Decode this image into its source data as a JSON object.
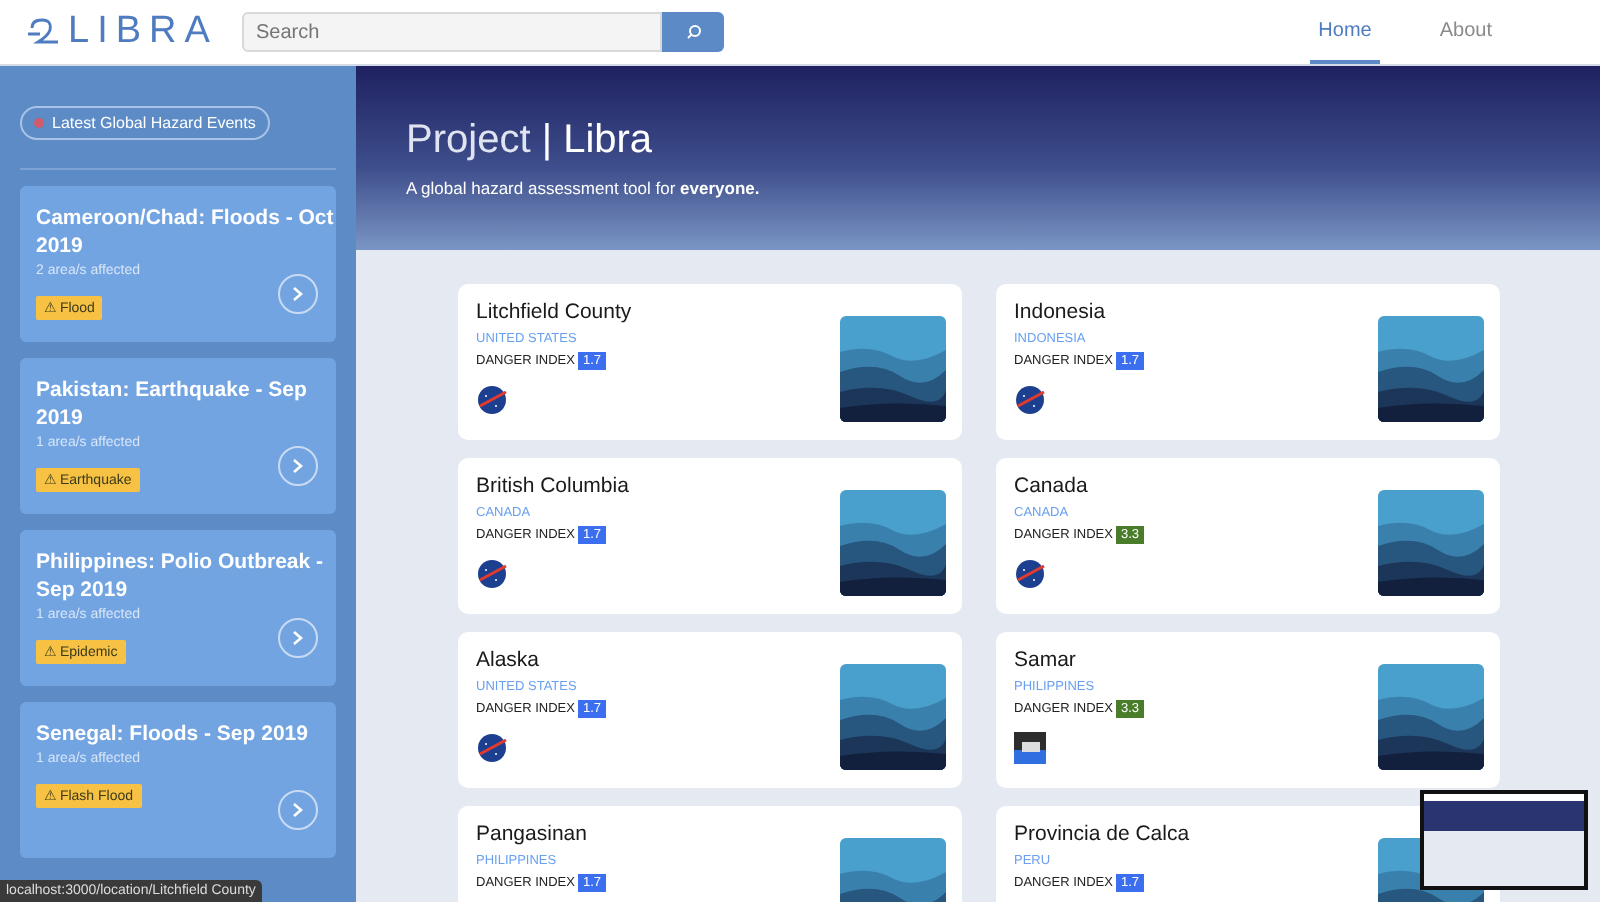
{
  "header": {
    "logo": "LIBRA",
    "search": {
      "placeholder": "Search"
    },
    "nav": [
      {
        "label": "Home",
        "selected": true
      },
      {
        "label": "About",
        "selected": false
      }
    ]
  },
  "sidebar": {
    "live_badge": "Latest Global Hazard Events",
    "events": [
      {
        "title": "Cameroon/Chad: Floods - Oct 2019",
        "affected": "2 area/s affected",
        "tag": "⚠ Flood"
      },
      {
        "title": "Pakistan: Earthquake - Sep 2019",
        "affected": "1 area/s affected",
        "tag": "⚠ Earthquake"
      },
      {
        "title": "Philippines: Polio Outbreak - Sep 2019",
        "affected": "1 area/s affected",
        "tag": "⚠ Epidemic"
      },
      {
        "title": "Senegal: Floods - Sep 2019",
        "affected": "1 area/s affected",
        "tag": "⚠ Flash Flood"
      }
    ]
  },
  "hero": {
    "title_light": "Project",
    "title_sep": "|",
    "title_bold": "Libra",
    "subtitle": "A global hazard assessment tool for **everyone.**"
  },
  "locations": [
    {
      "name": "Litchfield County",
      "country": "UNITED STATES",
      "index_label": "DANGER INDEX",
      "index": "1.7",
      "color": "#3b6ff0",
      "kind": "nasa"
    },
    {
      "name": "Indonesia",
      "country": "INDONESIA",
      "index_label": "DANGER INDEX",
      "index": "1.7",
      "color": "#3b6ff0",
      "kind": "nasa"
    },
    {
      "name": "British Columbia",
      "country": "CANADA",
      "index_label": "DANGER INDEX",
      "index": "1.7",
      "color": "#3b6ff0",
      "kind": "nasa"
    },
    {
      "name": "Canada",
      "country": "CANADA",
      "index_label": "DANGER INDEX",
      "index": "3.3",
      "color": "#4a7d2a",
      "kind": "nasa"
    },
    {
      "name": "Alaska",
      "country": "UNITED STATES",
      "index_label": "DANGER INDEX",
      "index": "1.7",
      "color": "#3b6ff0",
      "kind": "nasa"
    },
    {
      "name": "Samar",
      "country": "PHILIPPINES",
      "index_label": "DANGER INDEX",
      "index": "3.3",
      "color": "#4a7d2a",
      "kind": "noaa"
    },
    {
      "name": "Pangasinan",
      "country": "PHILIPPINES",
      "index_label": "DANGER INDEX",
      "index": "1.7",
      "color": "#3b6ff0"
    },
    {
      "name": "Provincia de Calca",
      "country": "PERU",
      "index_label": "DANGER INDEX",
      "index": "1.7",
      "color": "#3b6ff0"
    }
  ],
  "status_url": "localhost:3000/location/Litchfield County"
}
